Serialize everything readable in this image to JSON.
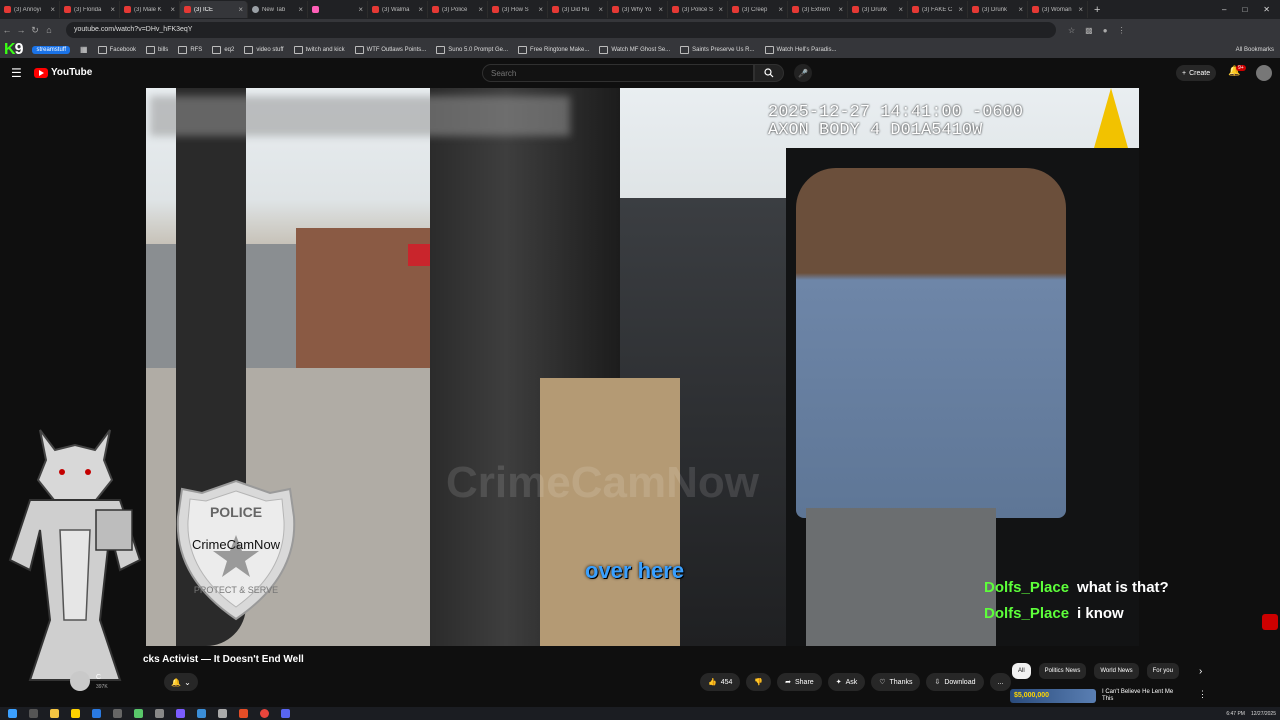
{
  "browser": {
    "tabs": [
      {
        "label": "(3) Annoyi",
        "icon": "youtube"
      },
      {
        "label": "(3) Florida",
        "icon": "youtube"
      },
      {
        "label": "(3) Male K",
        "icon": "youtube"
      },
      {
        "label": "(3) ICE",
        "icon": "youtube",
        "active": true
      },
      {
        "label": "New Tab",
        "icon": "chrome"
      },
      {
        "label": "",
        "icon": "pink"
      },
      {
        "label": "(3) Walma",
        "icon": "youtube"
      },
      {
        "label": "(3) Police",
        "icon": "youtube"
      },
      {
        "label": "(3) How S",
        "icon": "youtube"
      },
      {
        "label": "(3) Did Hu",
        "icon": "youtube"
      },
      {
        "label": "(3) Why Yo",
        "icon": "youtube"
      },
      {
        "label": "(3) Police S",
        "icon": "youtube"
      },
      {
        "label": "(3) Creep",
        "icon": "youtube"
      },
      {
        "label": "(3) Extrem",
        "icon": "youtube"
      },
      {
        "label": "(3) Drunk",
        "icon": "youtube"
      },
      {
        "label": "(3) FAKE C",
        "icon": "youtube"
      },
      {
        "label": "(3) Drunk",
        "icon": "youtube"
      },
      {
        "label": "(3) Woman",
        "icon": "youtube"
      }
    ],
    "new_tab": "+",
    "url": "youtube.com/watch?v=DHv_hFK3eqY",
    "bookmarks": [
      {
        "label": "Facebook"
      },
      {
        "label": "bills"
      },
      {
        "label": "RFS"
      },
      {
        "label": "eq2"
      },
      {
        "label": "video stuff"
      },
      {
        "label": "twitch and kick"
      },
      {
        "label": "WTF Outlaws Points..."
      },
      {
        "label": "Suno 5.0 Prompt Ge..."
      },
      {
        "label": "Free Ringtone Make..."
      },
      {
        "label": "Watch MF Ghost Se..."
      },
      {
        "label": "Saints Preserve Us R..."
      },
      {
        "label": "Watch Hell's Paradis..."
      }
    ],
    "bookmark_chip": "streamstuff",
    "all_bookmarks": "All Bookmarks"
  },
  "youtube": {
    "logo": "YouTube",
    "search_placeholder": "Search",
    "create_label": "Create",
    "notif_count": "9+"
  },
  "video": {
    "timestamp_line1": "2025-12-27 14:41:00 -0600",
    "timestamp_line2": "AXON BODY 4 D01A5410W",
    "caption": "over here",
    "watermark": "CrimeCamNow",
    "badge_top": "POLICE",
    "badge_mid": "CrimeCamNow",
    "badge_bottom": "PROTECT & SERVE"
  },
  "chat": [
    {
      "user": "Dolfs_Place",
      "message": "what is that?"
    },
    {
      "user": "Dolfs_Place",
      "message": "i know"
    }
  ],
  "below": {
    "title": "cks Activist — It Doesn't End Well",
    "channel_initial": "C",
    "channel_name": "C",
    "subscribers": "397K",
    "likes": "454",
    "actions": [
      "Share",
      "Ask",
      "Thanks",
      "Download"
    ],
    "more": "...",
    "chips": [
      "All",
      "Politics News",
      "World News",
      "For you"
    ],
    "rec_thumb_text": "$5,000,000",
    "rec_title": "I Can't Believe He Lent Me This"
  },
  "taskbar": {
    "time": "6:47 PM",
    "date": "12/27/2025"
  }
}
